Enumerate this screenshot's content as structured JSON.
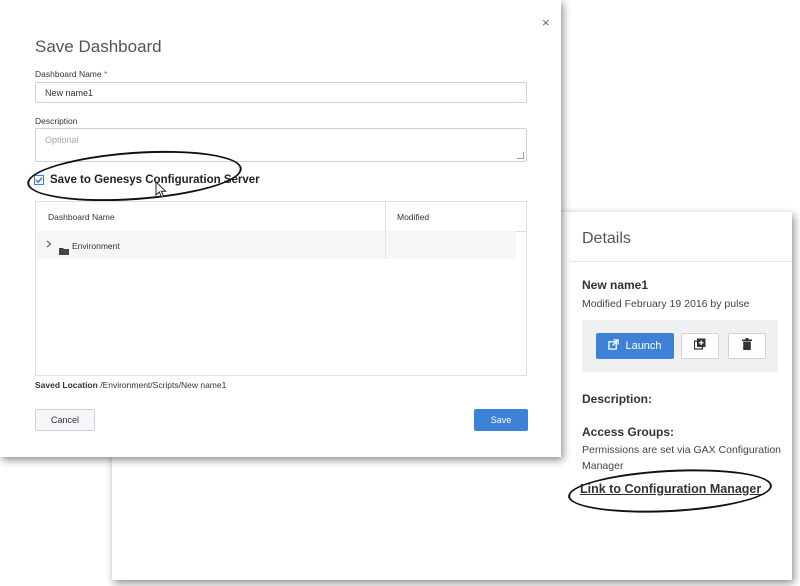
{
  "modal": {
    "title": "Save Dashboard",
    "close_glyph": "×",
    "name_label": "Dashboard Name",
    "required_mark": "*",
    "name_value": "New name1",
    "description_label": "Description",
    "description_placeholder": "Optional",
    "checkbox_label": "Save to Genesys Configuration Server",
    "checkbox_checked": true,
    "table": {
      "columns": [
        "Dashboard Name",
        "Modified"
      ],
      "rows": [
        {
          "name": "Environment",
          "modified": "",
          "icon": "folder-icon",
          "expand": "chevron-right-icon"
        }
      ]
    },
    "saved_location_label": "Saved Location",
    "saved_location_value": "/Environment/Scripts/New name1",
    "cancel_label": "Cancel",
    "save_label": "Save"
  },
  "details": {
    "title": "Details",
    "dashboard_name": "New name1",
    "modified_text": "Modified February 19 2016 by pulse",
    "launch_label": "Launch",
    "launch_icon": "external-link-icon",
    "copy_icon": "add-copy-icon",
    "delete_icon": "trash-icon",
    "description_label": "Description:",
    "access_groups_label": "Access Groups:",
    "access_groups_text": "Permissions are set via GAX Configuration Manager",
    "link_label": "Link to Configuration Manager"
  },
  "colors": {
    "primary_button": "#3e82d8",
    "required": "#d9534f",
    "annotation_oval": "#111111"
  }
}
